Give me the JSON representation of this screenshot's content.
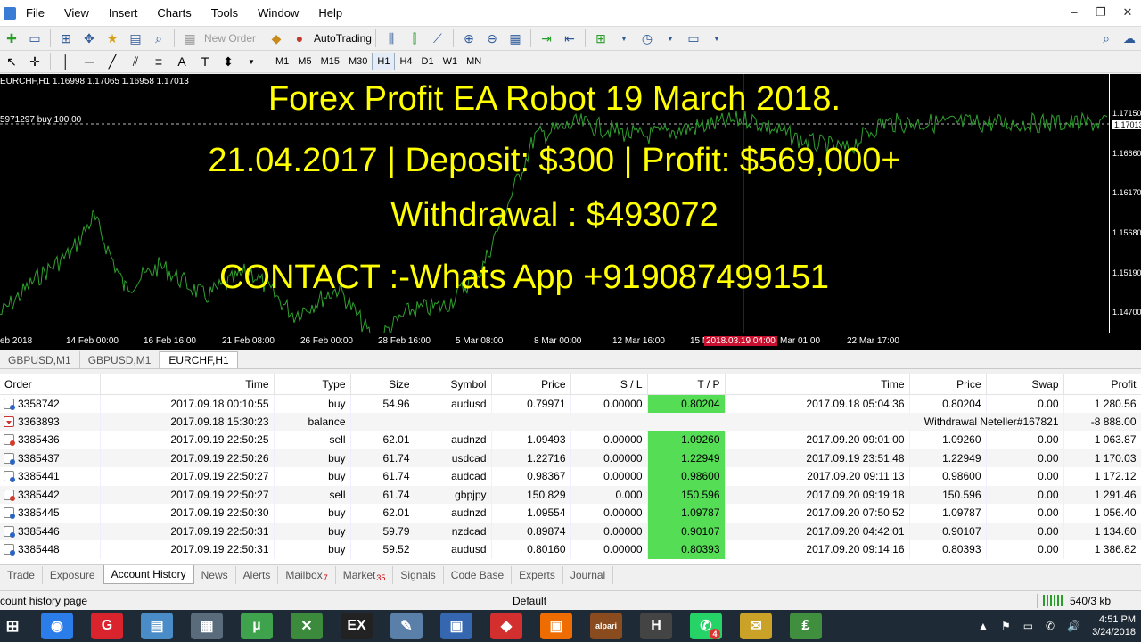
{
  "menu": {
    "items": [
      "File",
      "View",
      "Insert",
      "Charts",
      "Tools",
      "Window",
      "Help"
    ]
  },
  "window_controls": {
    "minimize": "–",
    "restore": "❐",
    "close": "✕"
  },
  "toolbar": {
    "new_order": "New Order",
    "autotrading": "AutoTrading",
    "timeframes": [
      "M1",
      "M5",
      "M15",
      "M30",
      "H1",
      "H4",
      "D1",
      "W1",
      "MN"
    ],
    "active_timeframe": "H1"
  },
  "chart": {
    "symbol_info": "EURCHF,H1  1.16998 1.17065 1.16958 1.17013",
    "order_line_label": "5971297 buy 100.00",
    "overlay_lines": [
      "Forex Profit  EA Robot 19 March 2018.",
      "21.04.2017 | Deposit: $300 |  Profit: $569,000+",
      "Withdrawal : $493072",
      "CONTACT :-Whats App +919087499151"
    ],
    "price_scale": [
      "1.17150",
      "1.17013",
      "1.16660",
      "1.16170",
      "1.15680",
      "1.15190",
      "1.14700"
    ],
    "current_price": "1.17013",
    "time_axis": [
      "eb 2018",
      "14 Feb 00:00",
      "16 Feb 16:00",
      "21 Feb 08:00",
      "26 Feb 00:00",
      "28 Feb 16:00",
      "5 Mar 08:00",
      "8 Mar 00:00",
      "12 Mar 16:00",
      "15 M",
      "2018.03.19 04:00",
      "Mar 01:00",
      "22 Mar 17:00"
    ],
    "colors": {
      "background": "#000000",
      "line": "#2ea12e",
      "overlay_text": "#ffff00"
    }
  },
  "chart_tabs": [
    "GBPUSD,M1",
    "GBPUSD,M1",
    "EURCHF,H1"
  ],
  "chart_tab_active": 2,
  "terminal": {
    "columns": [
      "Order",
      "Time",
      "Type",
      "Size",
      "Symbol",
      "Price",
      "S / L",
      "T / P",
      "Time",
      "Price",
      "Swap",
      "Profit"
    ],
    "rows": [
      {
        "kind": "buy",
        "order": "3358742",
        "time": "2017.09.18 00:10:55",
        "type": "buy",
        "size": "54.96",
        "symbol": "audusd",
        "price": "0.79971",
        "sl": "0.00000",
        "tp": "0.80204",
        "close_time": "2017.09.18 05:04:36",
        "close_price": "0.80204",
        "swap": "0.00",
        "profit": "1 280.56"
      },
      {
        "kind": "balance",
        "order": "3363893",
        "time": "2017.09.18 15:30:23",
        "type": "balance",
        "comment": "Withdrawal Neteller#167821",
        "profit": "-8 888.00"
      },
      {
        "kind": "sell",
        "order": "3385436",
        "time": "2017.09.19 22:50:25",
        "type": "sell",
        "size": "62.01",
        "symbol": "audnzd",
        "price": "1.09493",
        "sl": "0.00000",
        "tp": "1.09260",
        "close_time": "2017.09.20 09:01:00",
        "close_price": "1.09260",
        "swap": "0.00",
        "profit": "1 063.87"
      },
      {
        "kind": "buy",
        "order": "3385437",
        "time": "2017.09.19 22:50:26",
        "type": "buy",
        "size": "61.74",
        "symbol": "usdcad",
        "price": "1.22716",
        "sl": "0.00000",
        "tp": "1.22949",
        "close_time": "2017.09.19 23:51:48",
        "close_price": "1.22949",
        "swap": "0.00",
        "profit": "1 170.03"
      },
      {
        "kind": "buy",
        "order": "3385441",
        "time": "2017.09.19 22:50:27",
        "type": "buy",
        "size": "61.74",
        "symbol": "audcad",
        "price": "0.98367",
        "sl": "0.00000",
        "tp": "0.98600",
        "close_time": "2017.09.20 09:11:13",
        "close_price": "0.98600",
        "swap": "0.00",
        "profit": "1 172.12"
      },
      {
        "kind": "sell",
        "order": "3385442",
        "time": "2017.09.19 22:50:27",
        "type": "sell",
        "size": "61.74",
        "symbol": "gbpjpy",
        "price": "150.829",
        "sl": "0.000",
        "tp": "150.596",
        "close_time": "2017.09.20 09:19:18",
        "close_price": "150.596",
        "swap": "0.00",
        "profit": "1 291.46"
      },
      {
        "kind": "buy",
        "order": "3385445",
        "time": "2017.09.19 22:50:30",
        "type": "buy",
        "size": "62.01",
        "symbol": "audnzd",
        "price": "1.09554",
        "sl": "0.00000",
        "tp": "1.09787",
        "close_time": "2017.09.20 07:50:52",
        "close_price": "1.09787",
        "swap": "0.00",
        "profit": "1 056.40"
      },
      {
        "kind": "buy",
        "order": "3385446",
        "time": "2017.09.19 22:50:31",
        "type": "buy",
        "size": "59.79",
        "symbol": "nzdcad",
        "price": "0.89874",
        "sl": "0.00000",
        "tp": "0.90107",
        "close_time": "2017.09.20 04:42:01",
        "close_price": "0.90107",
        "swap": "0.00",
        "profit": "1 134.60"
      },
      {
        "kind": "buy",
        "order": "3385448",
        "time": "2017.09.19 22:50:31",
        "type": "buy",
        "size": "59.52",
        "symbol": "audusd",
        "price": "0.80160",
        "sl": "0.00000",
        "tp": "0.80393",
        "close_time": "2017.09.20 09:14:16",
        "close_price": "0.80393",
        "swap": "0.00",
        "profit": "1 386.82"
      }
    ],
    "tp_color": "#55dd55"
  },
  "bottom_tabs": [
    {
      "label": "Trade"
    },
    {
      "label": "Exposure"
    },
    {
      "label": "Account History",
      "active": true
    },
    {
      "label": "News"
    },
    {
      "label": "Alerts"
    },
    {
      "label": "Mailbox",
      "badge": "7"
    },
    {
      "label": "Market",
      "badge": "35"
    },
    {
      "label": "Signals"
    },
    {
      "label": "Code Base"
    },
    {
      "label": "Experts"
    },
    {
      "label": "Journal"
    }
  ],
  "status": {
    "hint": "count history page",
    "profile": "Default",
    "traffic": "540/3 kb"
  },
  "taskbar": {
    "apps": [
      {
        "name": "chrome",
        "glyph": "◉",
        "color": "#2b7de9"
      },
      {
        "name": "garena",
        "glyph": "G",
        "color": "#d9232d"
      },
      {
        "name": "notebook",
        "glyph": "▤",
        "color": "#4a8cc7"
      },
      {
        "name": "calculator",
        "glyph": "▦",
        "color": "#5a6b7c"
      },
      {
        "name": "utorrent",
        "glyph": "µ",
        "color": "#3fa34d"
      },
      {
        "name": "metatrader",
        "glyph": "✕",
        "color": "#3c8a3c"
      },
      {
        "name": "exness",
        "glyph": "EX",
        "color": "#222222"
      },
      {
        "name": "paint",
        "glyph": "✎",
        "color": "#5a7fa8"
      },
      {
        "name": "network",
        "glyph": "▣",
        "color": "#3566b0"
      },
      {
        "name": "red-app",
        "glyph": "◆",
        "color": "#d32f2f"
      },
      {
        "name": "orange-app",
        "glyph": "▣",
        "color": "#ef6c00"
      },
      {
        "name": "alpari",
        "glyph": "alpari",
        "color": "#8a4b1f"
      },
      {
        "name": "h-app",
        "glyph": "H",
        "color": "#444444"
      },
      {
        "name": "whatsapp",
        "glyph": "✆",
        "color": "#25d366",
        "badge": "4"
      },
      {
        "name": "notes",
        "glyph": "✉",
        "color": "#c9a227"
      },
      {
        "name": "terminal-active",
        "glyph": "₤",
        "color": "#3f8f3f"
      }
    ],
    "tray_icons": [
      "▲",
      "⚑",
      "▭",
      "✆",
      "🔊"
    ],
    "time": "4:51 PM",
    "date": "3/24/2018"
  }
}
